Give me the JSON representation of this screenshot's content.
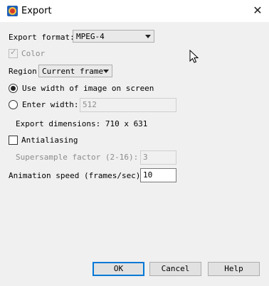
{
  "window": {
    "title": "Export",
    "close_glyph": "✕"
  },
  "export_format": {
    "label": "Export format:",
    "selected": "MPEG-4"
  },
  "color": {
    "label": "Color",
    "checked": true,
    "enabled": false
  },
  "region": {
    "label": "Region",
    "selected": "Current frame"
  },
  "size_mode": {
    "use_screen_width": {
      "label": "Use width of image on screen",
      "selected": true
    },
    "enter_width": {
      "label": "Enter width:",
      "selected": false,
      "value": "512"
    }
  },
  "export_dimensions": {
    "text": "Export dimensions: 710 x 631"
  },
  "antialiasing": {
    "label": "Antialiasing",
    "checked": false
  },
  "supersample": {
    "label": "Supersample factor (2-16):",
    "value": "3",
    "enabled": false
  },
  "animation_speed": {
    "label": "Animation speed (frames/sec):",
    "value": "10"
  },
  "buttons": {
    "ok": "OK",
    "cancel": "Cancel",
    "help": "Help"
  },
  "colors": {
    "accent": "#0078d7",
    "background": "#f0f0f0",
    "disabled_text": "#8c8c8c"
  },
  "icons": [
    "app-icon",
    "close-icon",
    "dropdown-arrow-icon",
    "checkmark-icon",
    "mouse-cursor-icon"
  ]
}
